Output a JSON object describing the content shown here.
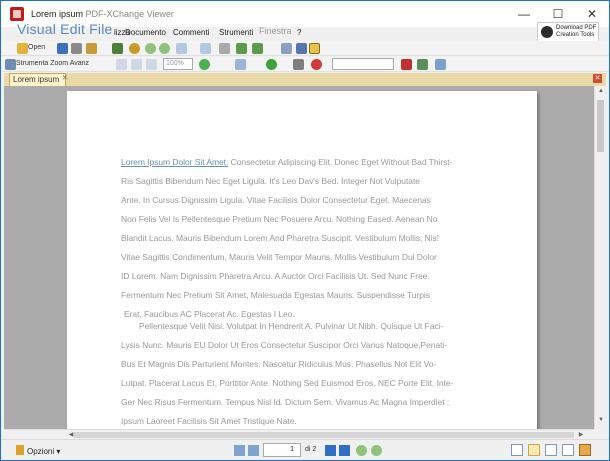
{
  "window": {
    "title": "Lorem ipsum",
    "title_overlay": "PDF-XChange Viewer",
    "minimize_glyph": "—",
    "maximize_glyph": "☐",
    "close_glyph": "✕"
  },
  "menu": {
    "overlay_title": "Visual Edit File",
    "items": [
      "lizza",
      "Documento",
      "Commenti",
      "Strumenti",
      "Finestra",
      "?"
    ]
  },
  "download": {
    "line1": "Download PDF",
    "line2": "Creation Tools"
  },
  "toolbar": {
    "open_label": "Open",
    "zoom_tool_label": "Zoom A",
    "instruments_label": "Strumenta Zoom Avanz",
    "zoom_value": "100%"
  },
  "tabs": [
    {
      "label": "Lorem ipsum"
    }
  ],
  "document": {
    "paragraph1": {
      "selected": "Lorem Ipsum Dolor Sit Amet.",
      "lines": [
        " Consectetur Adipiscing Elit. Donec Eget Without Bad Thirst-",
        "Ris Sagittis Bibendum Nec Eget Ligula. It's Leo Dav's Bed. Integer Not Vulputate",
        "Ante. In Cursus Dignissim Ligula. Vitae Facilisis Dolor Consectetur Eget. Maecenas",
        "Non Felis Vel Is Pellentesque Pretium Nec Posuere Arcu. Nothing Eased. Aenean No",
        "Blandit Lacus. Mauris Bibendum Lorem And Pharetra Suscipit. Vestibulum Mollis, Nis!",
        "Vitae Sagittis Condimentum, Mauris Velit Tempor Mauris. Mollis Vestibulum Dui Dolor",
        "ID Lorem. Nam Dignissim Pharetra Arcu. A Auctor Orci Facilisis Ut. Sed Nunc Free.",
        "Fermentum Nec Pretium Sit Amet, Malesuada Egestas Mauris. Suspendisse Turpis",
        "Erat, Faucibus AC Placerat Ac. Egestas I Leo."
      ]
    },
    "paragraph2": {
      "lines": [
        "Pellentesque Velit Nisi. Volutpat In Hendrerit A. Pulvinar Ut Nibh. Quisque Ut Faci-",
        "Lysis Nunc. Mauris EU Dolor Ut Eros Consectetur Suscipor Orci Varius Natoque,Penati-",
        "Bus Et Magnis Dis Parturient Montes. Nascetur Ridiculus Mus. Phasellus Not Elit Vo-",
        "Lutpat. Placerat Lacus Et, Porttitor Ante. Nothing Sed Euismod Eros, NEC Porte Elit. Inte-",
        "Ger Nec Risus Fermentum. Tempus Nisl Id. Dictum Sem. Vivamus Ac Magna Imperdiet :",
        "Ipsum Laoreet Facilisis Sit Amet Tristique Nate."
      ]
    }
  },
  "status": {
    "options_label": "Opzioni",
    "current_page": "1",
    "of_pages": "di 2"
  }
}
